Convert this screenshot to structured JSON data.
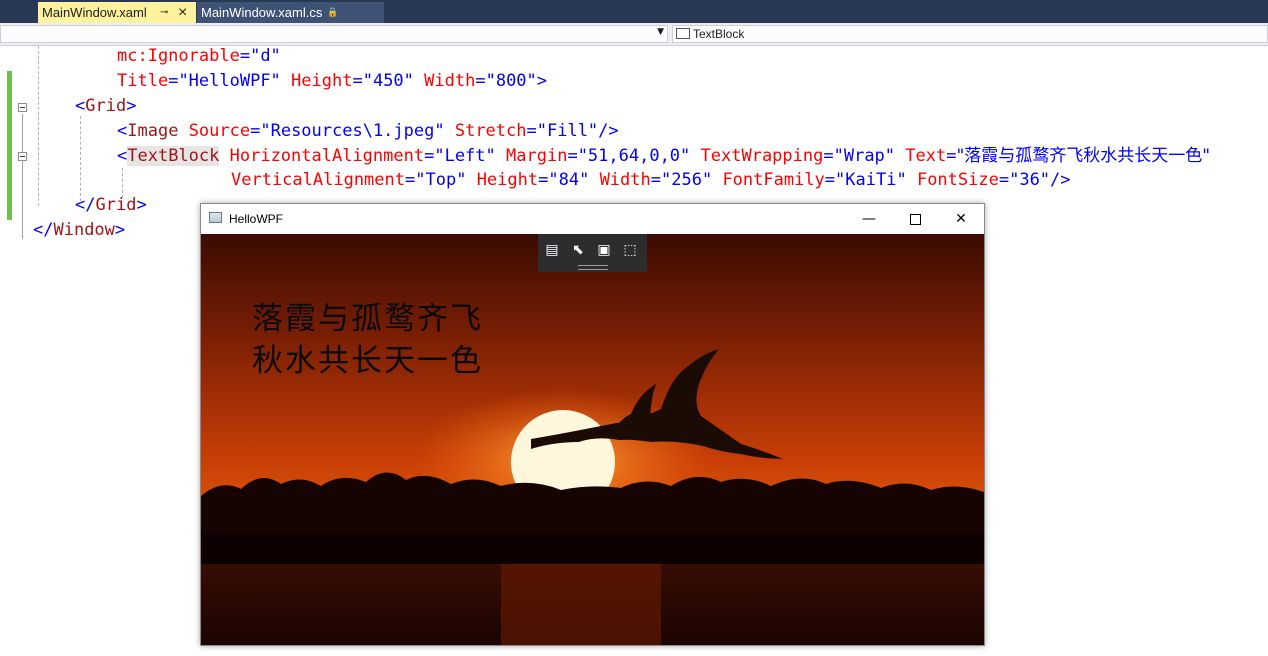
{
  "tabs": [
    {
      "label": "MainWindow.xaml",
      "active": true,
      "pin": "⊸",
      "close": "×"
    },
    {
      "label": "MainWindow.xaml.cs",
      "active": false,
      "lock": "🔒"
    }
  ],
  "navbar": {
    "left_value": "",
    "right_value": "TextBlock",
    "right_icon": "[⌶]"
  },
  "code": {
    "l1": {
      "attr": "mc:Ignorable",
      "eq": "=",
      "val": "\"d\""
    },
    "l2": {
      "attr1": "Title",
      "val1": "\"HelloWPF\"",
      "attr2": "Height",
      "val2": "\"450\"",
      "attr3": "Width",
      "val3": "\"800\"",
      "end": ">"
    },
    "l3": {
      "open": "<",
      "tag": "Grid",
      "close": ">"
    },
    "l4": {
      "open": "<",
      "tag": "Image",
      "attr1": "Source",
      "val1": "\"Resources\\1.jpeg\"",
      "attr2": "Stretch",
      "val2": "\"Fill\"",
      "close": "/>"
    },
    "l5": {
      "open": "<",
      "tag": "TextBlock",
      "attr1": "HorizontalAlignment",
      "val1": "\"Left\"",
      "attr2": "Margin",
      "val2": "\"51,64,0,0\"",
      "attr3": "TextWrapping",
      "val3": "\"Wrap\"",
      "attr4": "Text",
      "val4": "\"落霞与孤鹜齐飞秋水共长天一色\""
    },
    "l6": {
      "attr1": "VerticalAlignment",
      "val1": "\"Top\"",
      "attr2": "Height",
      "val2": "\"84\"",
      "attr3": "Width",
      "val3": "\"256\"",
      "attr4": "FontFamily",
      "val4": "\"KaiTi\"",
      "attr5": "FontSize",
      "val5": "\"36\"",
      "close": "/>"
    },
    "l7": {
      "open": "</",
      "tag": "Grid",
      "close": ">"
    },
    "l8": {
      "open": "</",
      "tag": "Window",
      "close": ">"
    }
  },
  "wpf_window": {
    "title": "HelloWPF",
    "minimize": "—",
    "close": "✕",
    "poem": "落霞与孤鹜齐飞秋水共长天一色"
  },
  "debug_toolbar": {
    "icons": [
      "live-visual-tree-icon",
      "select-element-icon",
      "display-layout-adorners-icon",
      "track-focus-icon"
    ],
    "glyphs": [
      "▤",
      "⬉",
      "▣",
      "⬚"
    ]
  },
  "colors": {
    "tag": "#a31515",
    "attribute": "#ff0000",
    "value": "#0000ff",
    "active_tab": "#fff29d",
    "tab_strip": "#293955",
    "change_bar": "#6fc04e"
  }
}
